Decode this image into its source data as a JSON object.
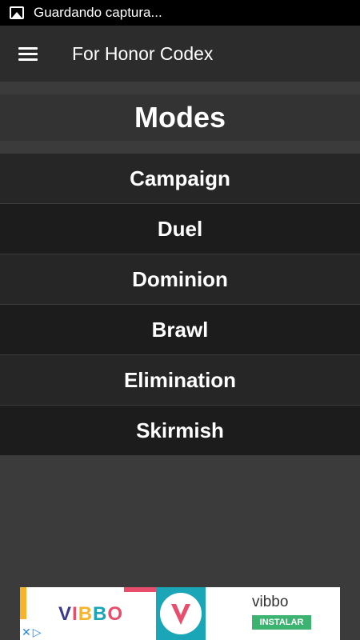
{
  "status_bar": {
    "icon": "image-icon",
    "text": "Guardando captura..."
  },
  "app_bar": {
    "menu_icon": "hamburger-menu-icon",
    "title": "For Honor Codex"
  },
  "section": {
    "title": "Modes"
  },
  "modes": [
    {
      "label": "Campaign"
    },
    {
      "label": "Duel"
    },
    {
      "label": "Dominion"
    },
    {
      "label": "Brawl"
    },
    {
      "label": "Elimination"
    },
    {
      "label": "Skirmish"
    }
  ],
  "ad": {
    "logo_text": "VIBBO",
    "brand": "vibbo",
    "install_label": "INSTALAR",
    "close_symbol": "✕",
    "adchoices_symbol": "▷",
    "colors": {
      "install": "#3cb371",
      "icon_bg": "#1aa6b7"
    }
  },
  "colors": {
    "background": "#3b3b3b",
    "app_bar": "#2c2c2c",
    "row_odd": "#262626",
    "row_even": "#1c1c1c",
    "text": "#ffffff"
  }
}
